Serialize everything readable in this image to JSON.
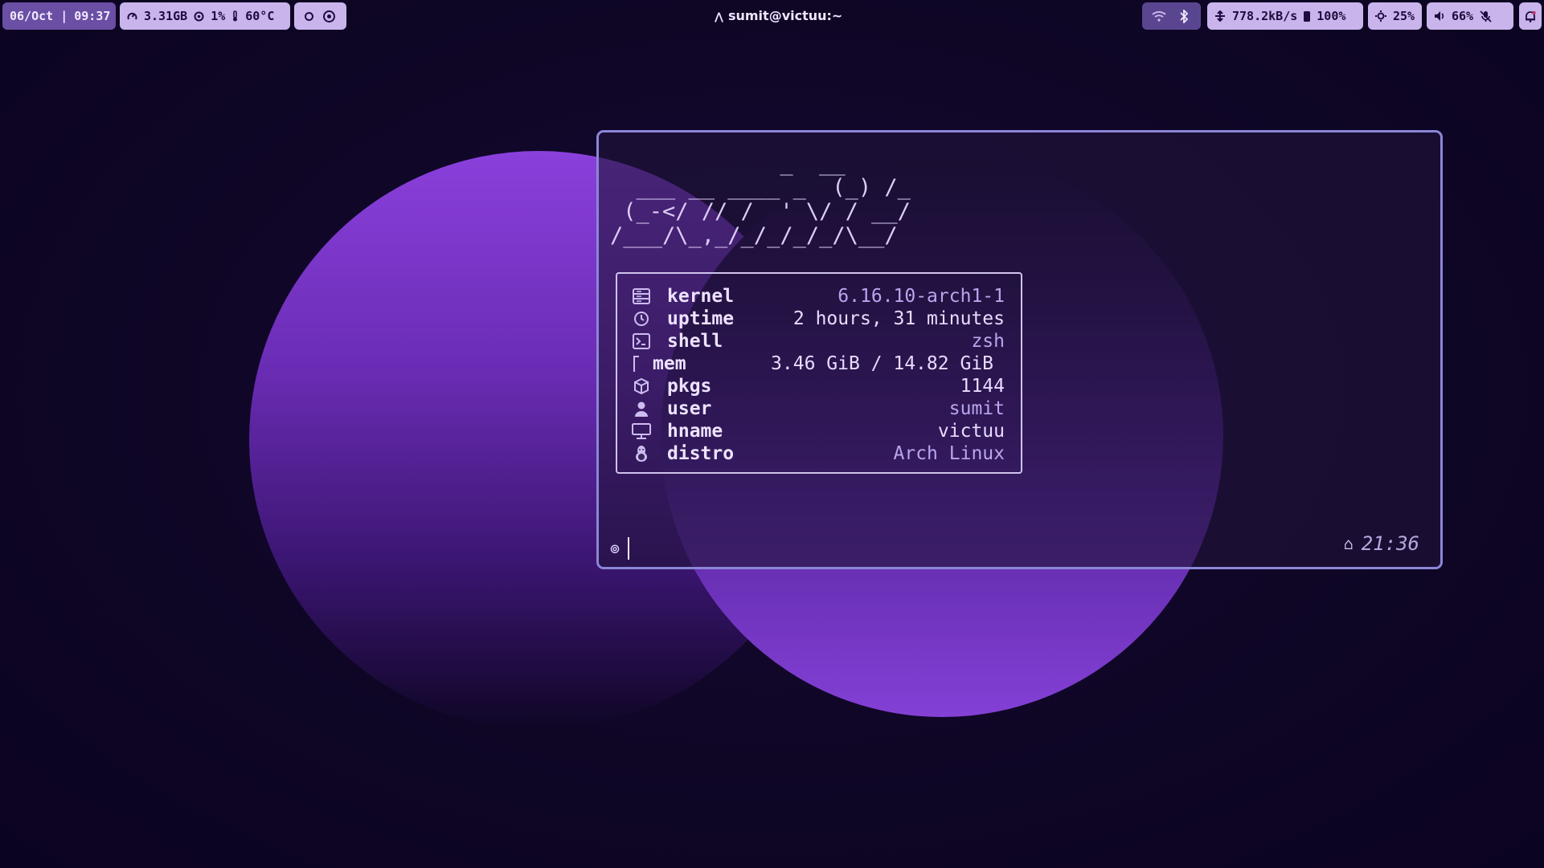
{
  "topbar": {
    "date_time": {
      "date": "06/Oct |",
      "time": "09:37"
    },
    "system": {
      "memory": "3.31GB",
      "cpu": "1%",
      "temp": "60°C"
    },
    "workspaces": [
      "empty",
      "active"
    ],
    "window_title": "sumit@victuu:~",
    "connectivity": {
      "wifi_icon": "wifi-icon",
      "bluetooth_icon": "bluetooth-icon"
    },
    "net_battery": {
      "network_speed": "778.2kB/s",
      "battery": "100%"
    },
    "brightness": "25%",
    "audio": {
      "volume": "66%"
    }
  },
  "terminal": {
    "ascii_art": "             _  __\n  ___ __ ____ _  (_) /_\n (_-</ // /  ' \\/ / __/\n/___/\\_,_/_/_/_/_/\\__/",
    "info": [
      {
        "icon": "server-icon",
        "key": "kernel",
        "value": "6.16.10-arch1-1"
      },
      {
        "icon": "clock-icon",
        "key": "uptime",
        "value": "2 hours, 31 minutes"
      },
      {
        "icon": "terminal-icon",
        "key": "shell",
        "value": "zsh"
      },
      {
        "icon": "memory-icon",
        "key": "mem",
        "value": "3.46 GiB / 14.82 GiB"
      },
      {
        "icon": "package-icon",
        "key": "pkgs",
        "value": "1144"
      },
      {
        "icon": "user-icon",
        "key": "user",
        "value": "sumit"
      },
      {
        "icon": "monitor-icon",
        "key": "hname",
        "value": "victuu"
      },
      {
        "icon": "linux-icon",
        "key": "distro",
        "value": "Arch Linux"
      }
    ],
    "prompt_symbol": "⊚",
    "right_prompt": {
      "home_symbol": "⌂",
      "time": "21:36"
    }
  },
  "colors": {
    "background": "#0f0626",
    "pill": "#c9b4ec",
    "accent_purple": "#8a40dc",
    "terminal_border": "#8b86d8"
  }
}
